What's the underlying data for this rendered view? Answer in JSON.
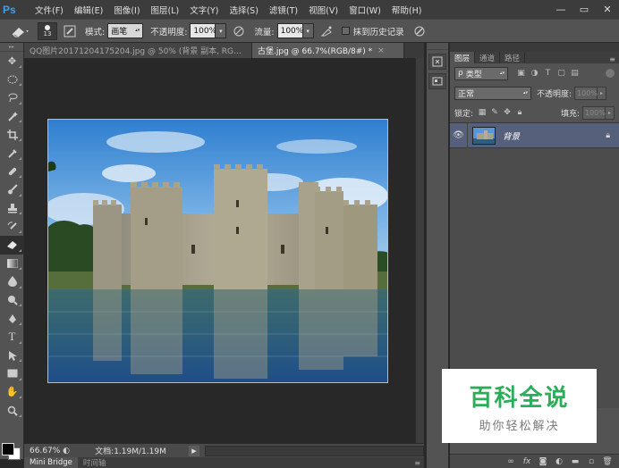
{
  "app": {
    "logo": "Ps"
  },
  "menu": [
    "文件(F)",
    "编辑(E)",
    "图像(I)",
    "图层(L)",
    "文字(Y)",
    "选择(S)",
    "滤镜(T)",
    "视图(V)",
    "窗口(W)",
    "帮助(H)"
  ],
  "window_controls": {
    "minimize": "—",
    "restore": "▭",
    "close": "✕"
  },
  "options": {
    "brush_size": "13",
    "mode_label": "模式:",
    "mode_value": "画笔",
    "opacity_label": "不透明度:",
    "opacity_value": "100%",
    "flow_label": "流量:",
    "flow_value": "100%",
    "erase_history_label": "抹到历史记录"
  },
  "tabs": [
    {
      "label": "QQ图片20171204175204.jpg @ 50% (背景 副本, RGB/...",
      "active": false
    },
    {
      "label": "古堡.jpg @ 66.7%(RGB/8#) *",
      "active": true
    }
  ],
  "tab_close": "×",
  "status": {
    "zoom": "66.67%",
    "doc": "文档:1.19M/1.19M"
  },
  "bottom_tabs": [
    "Mini Bridge",
    "时间轴"
  ],
  "layers_panel": {
    "tabs": [
      "图层",
      "通道",
      "路径"
    ],
    "filter_label": "类型",
    "blend_mode": "正常",
    "opacity_label": "不透明度:",
    "opacity_value": "100%",
    "lock_label": "锁定:",
    "fill_label": "填充:",
    "fill_value": "100%",
    "layers": [
      {
        "name": "背景",
        "locked": true,
        "visible": true
      }
    ]
  },
  "watermark": {
    "title": "百科全说",
    "subtitle": "助你轻松解决"
  },
  "colors": {
    "accent": "#3aa0f4",
    "selected_layer": "#56607a",
    "watermark_green": "#2aae57"
  }
}
